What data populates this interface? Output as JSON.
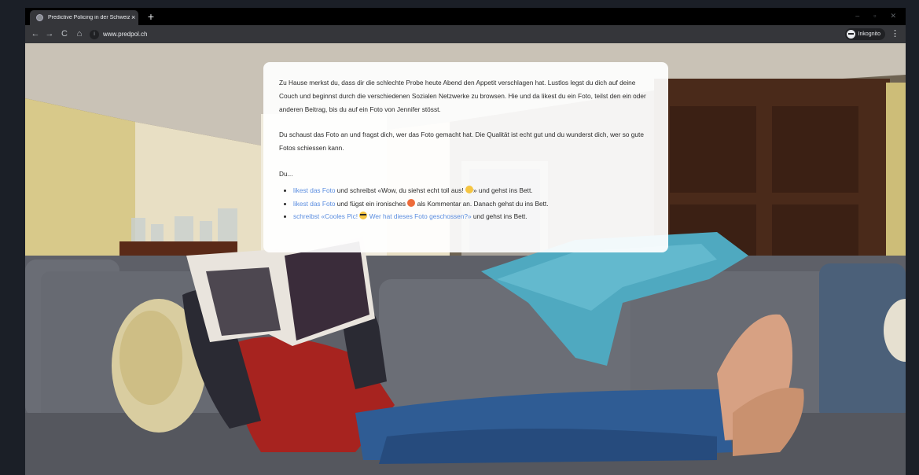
{
  "browser": {
    "tab_title": "Predictive Policing in der Schweiz",
    "tab_close": "×",
    "new_tab": "+",
    "url": "www.predpol.ch",
    "incognito_label": "Inkognito",
    "menu_glyph": "⋮",
    "nav": {
      "back": "←",
      "forward": "→",
      "reload": "C",
      "home": "⌂"
    },
    "window_controls": {
      "minimize": "–",
      "maximize": "▫",
      "close": "✕"
    }
  },
  "story": {
    "paragraph1": "Zu Hause merkst du, dass dir die schlechte Probe heute Abend den Appetit verschlagen hat. Lustlos legst du dich auf deine Couch und beginnst durch die verschiedenen Sozialen Netzwerke zu browsen. Hie und da likest du ein Foto, teilst den ein oder anderen Beitrag, bis du auf ein Foto von Jennifer stösst.",
    "paragraph2": "Du schaust das Foto an und fragst dich, wer das Foto gemacht hat. Die Qualität ist echt gut und du wunderst dich, wer so gute Fotos schiessen kann.",
    "prompt": "Du...",
    "options": [
      {
        "link": "likest das Foto",
        "text_before": " und schreibst «Wow, du siehst echt toll aus! ",
        "text_after": "» und gehst ins Bett."
      },
      {
        "link": "likest das Foto",
        "text_before": " und fügst ein ironisches ",
        "text_after": " als Kommentar an. Danach gehst du ins Bett."
      },
      {
        "link_a": "schreibst «Cooles Pic! ",
        "link_b": " Wer hat dieses Foto geschossen?»",
        "text_after": " und gehst ins Bett."
      }
    ],
    "emoji_icons": [
      "star-struck-emoji-icon",
      "heart-eyes-emoji-icon",
      "sunglasses-emoji-icon"
    ]
  },
  "colors": {
    "link": "#5a8de0",
    "tabstrip": "#000000",
    "toolbar": "#35363a"
  }
}
